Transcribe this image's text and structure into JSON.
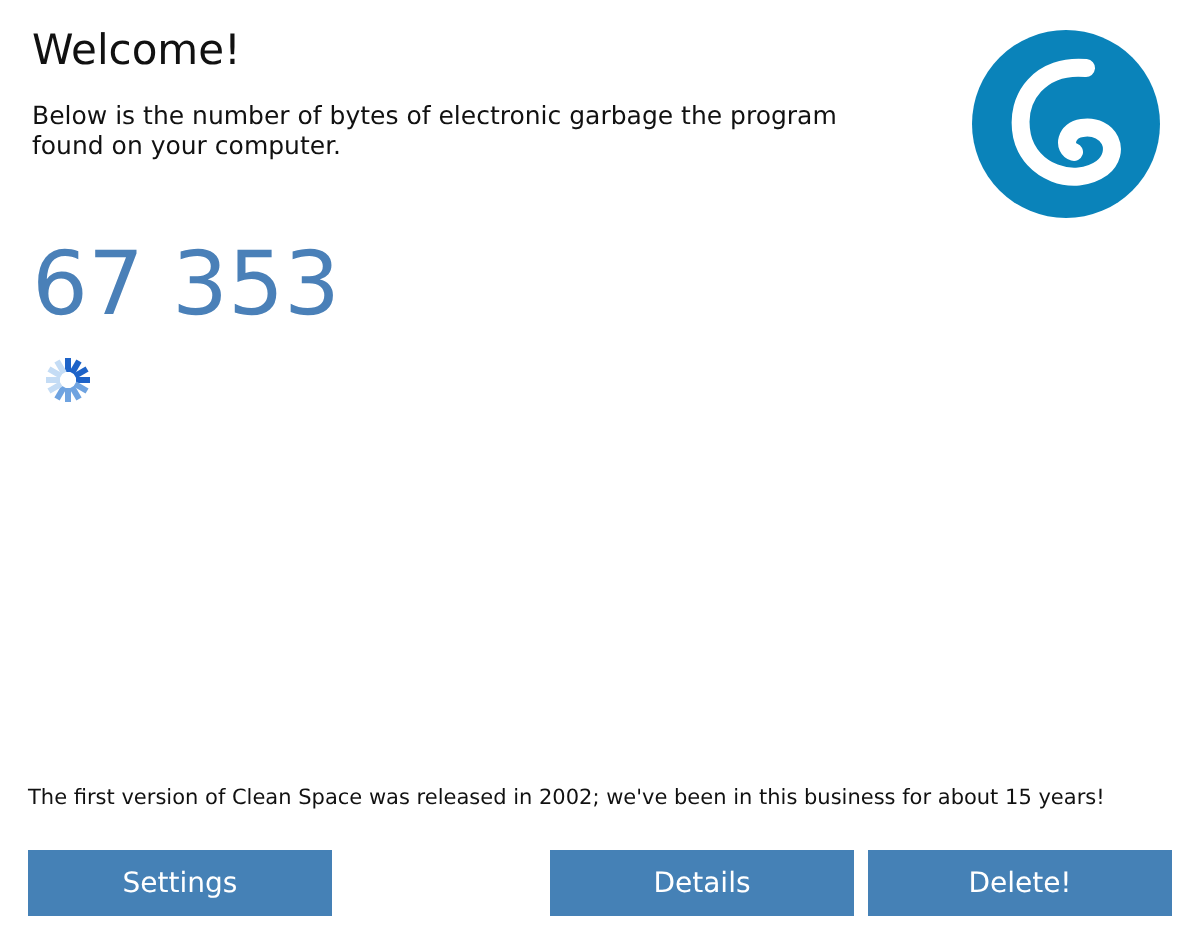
{
  "title": "Welcome!",
  "description": "Below is the number of bytes of electronic garbage the program found on your computer.",
  "bytes_found": "67 353",
  "footer_note": "The first version of Clean Space was released in 2002; we've been in this business for about 15 years!",
  "buttons": [
    {
      "label": "Settings",
      "kind": "left"
    },
    {
      "label": "Details",
      "kind": "right"
    },
    {
      "label": "Delete!",
      "kind": "right"
    }
  ]
}
